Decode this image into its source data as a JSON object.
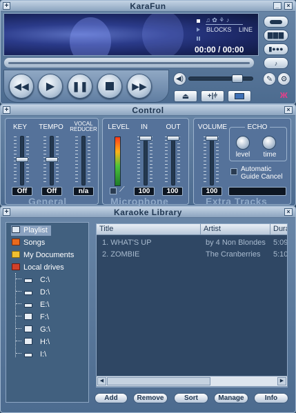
{
  "player": {
    "title": "KaraFun",
    "option_blocks": "BLOCKS",
    "option_line": "LINE",
    "time": "00:00 / 00:00"
  },
  "control": {
    "title": "Control",
    "key_label": "KEY",
    "tempo_label": "TEMPO",
    "vocal_label_1": "VOCAL",
    "vocal_label_2": "REDUCER",
    "key_value": "Off",
    "tempo_value": "Off",
    "vocal_value": "n/a",
    "general_title": "General",
    "level_label": "LEVEL",
    "in_label": "IN",
    "out_label": "OUT",
    "in_value": "100",
    "out_value": "100",
    "microphone_title": "Microphone",
    "volume_label": "VOLUME",
    "volume_value": "100",
    "echo_label": "ECHO",
    "echo_level_label": "level",
    "echo_time_label": "time",
    "auto_guide_1": "Automatic",
    "auto_guide_2": "Guide Cancel",
    "extra_tracks_title": "Extra Tracks"
  },
  "library": {
    "title": "Karaoke Library",
    "tree": [
      {
        "label": "Playlist",
        "icon": "playlist-icon"
      },
      {
        "label": "Songs",
        "icon": "songs-icon"
      },
      {
        "label": "My Documents",
        "icon": "folder-icon"
      },
      {
        "label": "Local drives",
        "icon": "drives-icon"
      },
      {
        "label": "C:\\",
        "icon": "hard-drive-icon"
      },
      {
        "label": "D:\\",
        "icon": "hard-drive-icon"
      },
      {
        "label": "E:\\",
        "icon": "hard-drive-icon"
      },
      {
        "label": "F:\\",
        "icon": "removable-drive-icon"
      },
      {
        "label": "G:\\",
        "icon": "removable-drive-icon"
      },
      {
        "label": "H:\\",
        "icon": "removable-drive-icon"
      },
      {
        "label": "I:\\",
        "icon": "hard-drive-icon"
      }
    ],
    "columns": [
      "Title",
      "Artist",
      "Dura"
    ],
    "rows": [
      {
        "title": "1. WHAT'S UP",
        "artist": "by 4 Non Blondes",
        "duration": "5:09"
      },
      {
        "title": "2. ZOMBIE",
        "artist": "The Cranberries",
        "duration": "5:10"
      }
    ],
    "buttons": {
      "add": "Add",
      "remove": "Remove",
      "sort": "Sort",
      "manage": "Manage",
      "info": "Info"
    }
  },
  "colors": {
    "panel": "#4c6b8f",
    "screen": "#2b3b8a",
    "value_box": "#0d1622"
  }
}
